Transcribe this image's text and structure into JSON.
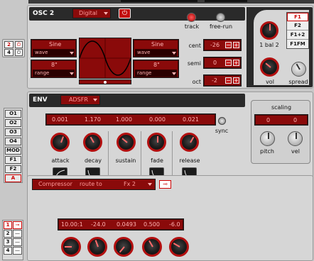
{
  "osc2": {
    "title": "OSC 2",
    "mode": "Digital",
    "track_label": "track",
    "freerun_label": "free-run",
    "wave1": {
      "name": "Sine",
      "sub": "wave"
    },
    "range1": {
      "name": "8\"",
      "sub": "range"
    },
    "wave2": {
      "name": "Sine",
      "sub": "wave"
    },
    "range2": {
      "name": "8\"",
      "sub": "range"
    },
    "cent_label": "cent",
    "cent_value": "-26",
    "semi_label": "semi",
    "semi_value": "0",
    "oct_label": "oct",
    "oct_value": "-2",
    "f_buttons": [
      "F1",
      "F2",
      "F1+2",
      "F1FM"
    ],
    "bal_label": "1 bal 2",
    "vol_label": "vol",
    "spread_label": "spread",
    "minus_symbol": "−",
    "plus_symbol": "+"
  },
  "side_left_top": [
    "2",
    "4"
  ],
  "env": {
    "title": "ENV",
    "mode": "ADSFR",
    "values": [
      "0.001",
      "1.170",
      "1.000",
      "0.000",
      "0.021"
    ],
    "sync_label": "sync",
    "knobs": [
      "attack",
      "decay",
      "sustain",
      "fade",
      "release"
    ],
    "scaling_title": "scaling",
    "scaling_values": [
      "0",
      "0"
    ],
    "scaling_knobs": [
      "pitch",
      "vel"
    ]
  },
  "env_targets": [
    "O1",
    "O2",
    "O3",
    "O4",
    "MOD",
    "F1",
    "F2",
    "A"
  ],
  "fx": {
    "effect": "Compressor",
    "route_label": "route to",
    "route_target": "Fx 2",
    "values": [
      "10.00:1",
      "-24.0",
      "0.0493",
      "0.500",
      "-6.0"
    ]
  },
  "fx_slots": [
    "1",
    "2",
    "3",
    "4"
  ],
  "colors": {
    "accent_red": "#b31010",
    "lcd_bg": "#8a0a0a",
    "lcd_text": "#ffb3b3",
    "panel": "#d3d3d3"
  }
}
